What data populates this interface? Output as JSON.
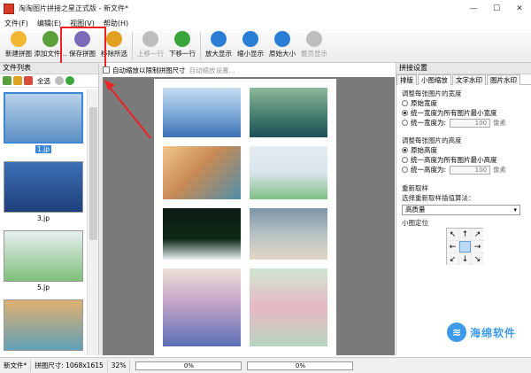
{
  "window": {
    "title": "淘淘图片拼接之星正式版 - 新文件*"
  },
  "menu": [
    "文件(F)",
    "编辑(E)",
    "视图(V)",
    "帮助(H)"
  ],
  "toolbar": [
    {
      "label": "新建拼图",
      "icon": "new-puzzle-icon",
      "color": "#f2b632",
      "enabled": true
    },
    {
      "label": "添加文件...",
      "icon": "add-file-icon",
      "color": "#5a9f3a",
      "enabled": true
    },
    {
      "label": "保存拼图",
      "icon": "save-puzzle-icon",
      "color": "#7a6ab8",
      "enabled": true
    },
    {
      "label": "移除所选",
      "icon": "remove-selected-icon",
      "color": "#e0a020",
      "enabled": true
    },
    {
      "label": "上移一行",
      "icon": "move-up-icon",
      "color": "#bdbdbd",
      "enabled": false
    },
    {
      "label": "下移一行",
      "icon": "move-down-icon",
      "color": "#3aa53a",
      "enabled": true
    },
    {
      "label": "放大显示",
      "icon": "zoom-in-icon",
      "color": "#2a7fd4",
      "enabled": true
    },
    {
      "label": "缩小显示",
      "icon": "zoom-out-icon",
      "color": "#2a7fd4",
      "enabled": true
    },
    {
      "label": "原始大小",
      "icon": "original-size-icon",
      "color": "#2a7fd4",
      "enabled": true
    },
    {
      "label": "整页显示",
      "icon": "fit-page-icon",
      "color": "#bdbdbd",
      "enabled": false
    }
  ],
  "file_list": {
    "title": "文件列表",
    "select_all": "全选",
    "items": [
      {
        "label": "1.jp",
        "selected": true,
        "colors": [
          "#b9d3ea",
          "#5c8fc4"
        ]
      },
      {
        "label": "3.jp",
        "selected": false,
        "colors": [
          "#3d6fb5",
          "#1d3f7a"
        ]
      },
      {
        "label": "5.jp",
        "selected": false,
        "colors": [
          "#e8eef3",
          "#7ec07a"
        ]
      },
      {
        "label": "",
        "selected": false,
        "colors": [
          "#e0b070",
          "#5fa0b8"
        ]
      }
    ]
  },
  "canvas_options": {
    "auto_scale": "自动缩放以限制拼图尺寸",
    "auto_scale_settings": "自动缩放设置..."
  },
  "right_panel": {
    "title": "拼接设置",
    "tabs": [
      "排版",
      "小图缩放",
      "文字水印",
      "图片水印"
    ],
    "active_tab": 1,
    "width_section": {
      "title": "调整每张图片的宽度",
      "options": [
        "原始宽度",
        "统一宽度为所有图片最小宽度",
        "统一宽度为:"
      ],
      "selected": 1,
      "value": "100",
      "unit": "像素"
    },
    "height_section": {
      "title": "调整每张图片的高度",
      "options": [
        "原始高度",
        "统一高度为所有图片最小高度",
        "统一高度为:"
      ],
      "selected": 0,
      "value": "100",
      "unit": "像素"
    },
    "resample": {
      "title": "重新取样",
      "label": "选择重新取样插值算法：",
      "value": "高质量"
    },
    "position": {
      "title": "小图定位",
      "arrows": [
        "↖",
        "↑",
        "↗",
        "←",
        "",
        "→",
        "↙",
        "↓",
        "↘"
      ]
    }
  },
  "statusbar": {
    "file": "新文件*",
    "size": "拼图尺寸: 1068x1615",
    "zoom": "32%",
    "progress1": "0%",
    "progress2": "0%"
  },
  "watermark": {
    "text": "海绵软件"
  }
}
